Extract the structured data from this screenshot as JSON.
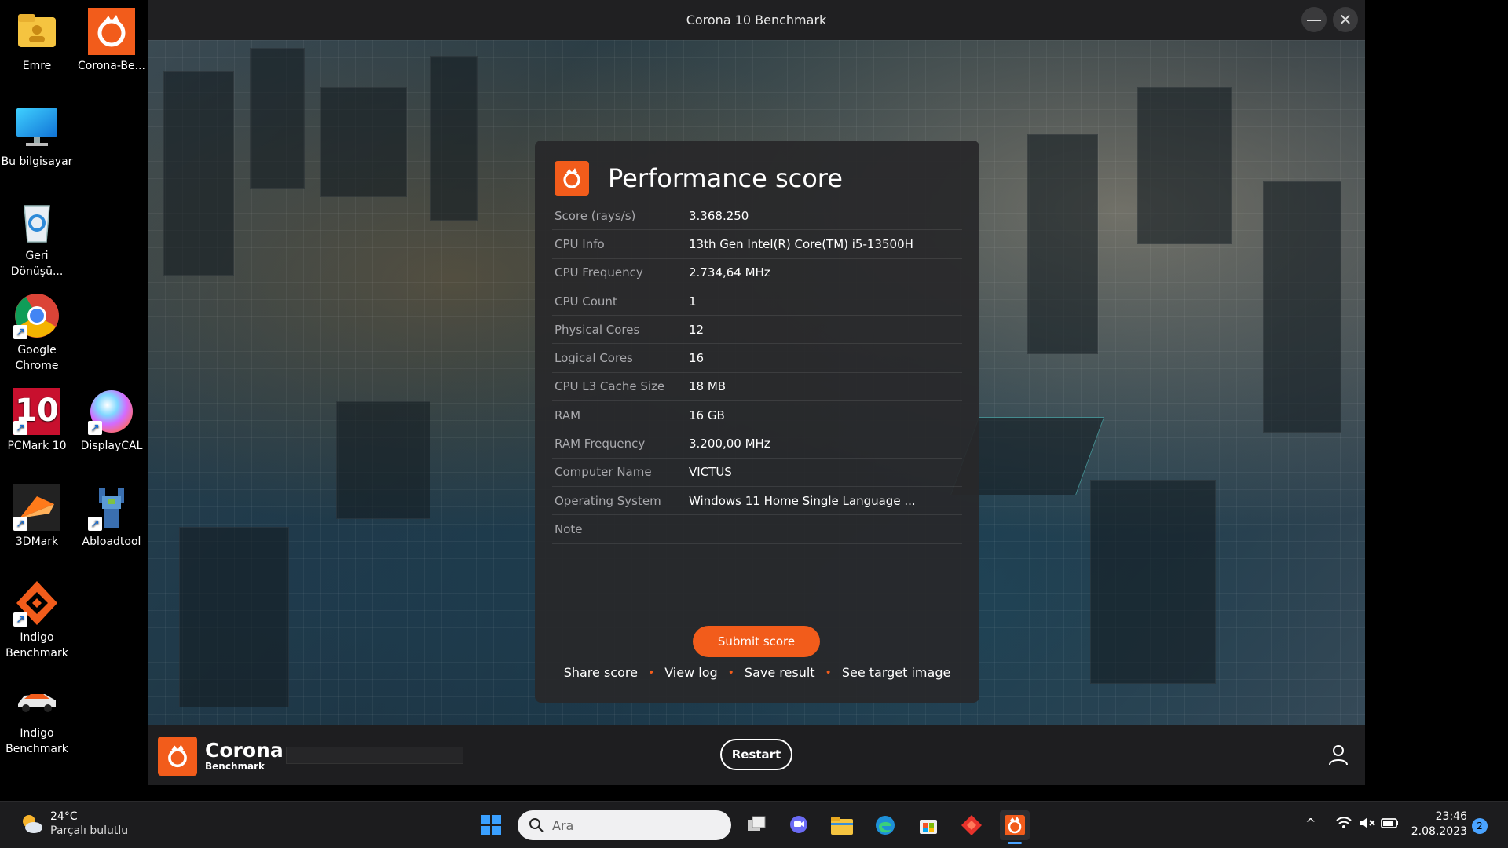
{
  "desktop": {
    "icons": [
      {
        "label": "Emre"
      },
      {
        "label": "Corona-Be..."
      },
      {
        "label": "Bu bilgisayar"
      },
      {
        "label": "Geri Dönüşü..."
      },
      {
        "label": "Google Chrome"
      },
      {
        "label": "PCMark 10"
      },
      {
        "label": "DisplayCAL"
      },
      {
        "label": "3DMark"
      },
      {
        "label": "Abloadtool"
      },
      {
        "label": "Indigo Benchmark"
      },
      {
        "label": "Indigo Benchmark"
      }
    ],
    "pcmark_badge": "10"
  },
  "window": {
    "title": "Corona 10 Benchmark",
    "minimize_glyph": "—",
    "close_glyph": "✕"
  },
  "panel": {
    "title": "Performance score",
    "rows": [
      {
        "key": "Score (rays/s)",
        "value": "3.368.250"
      },
      {
        "key": "CPU Info",
        "value": "13th Gen Intel(R) Core(TM) i5-13500H"
      },
      {
        "key": "CPU Frequency",
        "value": "2.734,64 MHz"
      },
      {
        "key": "CPU Count",
        "value": "1"
      },
      {
        "key": "Physical Cores",
        "value": "12"
      },
      {
        "key": "Logical Cores",
        "value": "16"
      },
      {
        "key": "CPU L3 Cache Size",
        "value": "18 MB"
      },
      {
        "key": "RAM",
        "value": "16 GB"
      },
      {
        "key": "RAM Frequency",
        "value": "3.200,00 MHz"
      },
      {
        "key": "Computer Name",
        "value": "VICTUS"
      },
      {
        "key": "Operating System",
        "value": "Windows 11 Home Single Language ..."
      },
      {
        "key": "Note",
        "value": ""
      }
    ],
    "submit_label": "Submit score",
    "links": [
      "Share score",
      "View log",
      "Save result",
      "See target image"
    ],
    "link_separator": "•"
  },
  "appbar": {
    "brand_name": "Corona",
    "brand_sub": "Benchmark",
    "restart_label": "Restart"
  },
  "taskbar": {
    "weather_temp": "24°C",
    "weather_desc": "Parçalı bulutlu",
    "search_placeholder": "Ara",
    "time": "23:46",
    "date": "2.08.2023",
    "notification_count": "2",
    "tray_chevron": "^"
  },
  "colors": {
    "accent": "#f25c1b",
    "panel_bg": "#28282a",
    "titlebar_bg": "#202022",
    "taskbar_bg": "#1c1c1e"
  }
}
